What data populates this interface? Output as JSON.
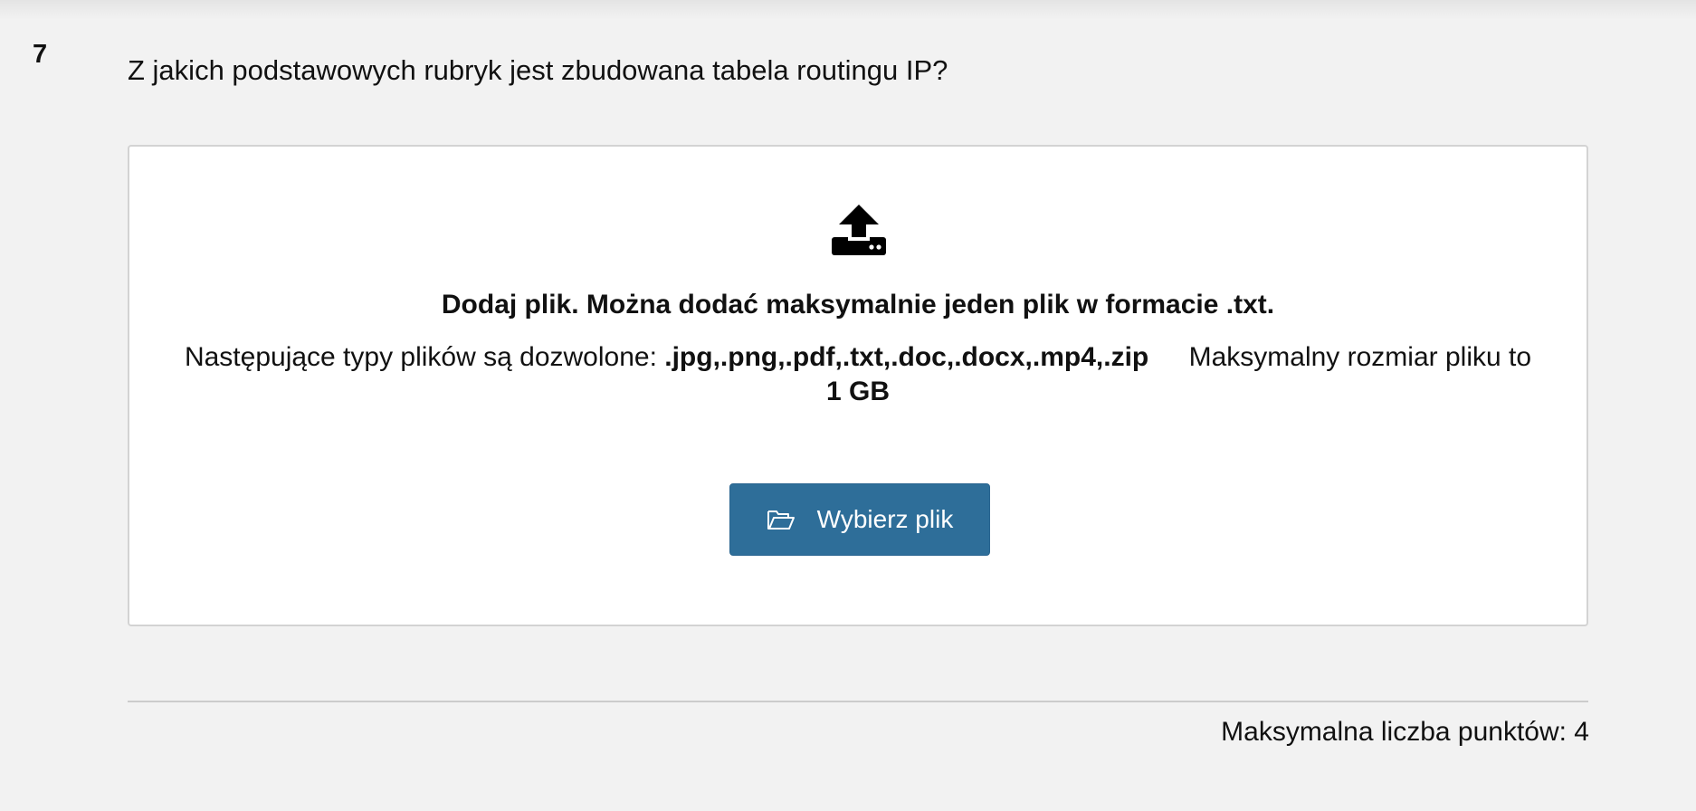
{
  "question": {
    "number": "7",
    "text": "Z jakich podstawowych rubryk jest zbudowana tabela routingu IP?"
  },
  "upload": {
    "icon": "upload-icon",
    "title": "Dodaj plik. Można dodać maksymalnie jeden plik w formacie .txt.",
    "allowed_prefix": "Następujące typy plików są dozwolone:",
    "allowed_types": ".jpg,.png,.pdf,.txt,.doc,.docx,.mp4,.zip",
    "max_size_prefix": "Maksymalny rozmiar pliku to",
    "max_size": "1 GB",
    "button_label": "Wybierz plik",
    "button_icon": "folder-open-icon",
    "button_color": "#2e6e99"
  },
  "footer": {
    "max_points": "Maksymalna liczba punktów: 4"
  }
}
